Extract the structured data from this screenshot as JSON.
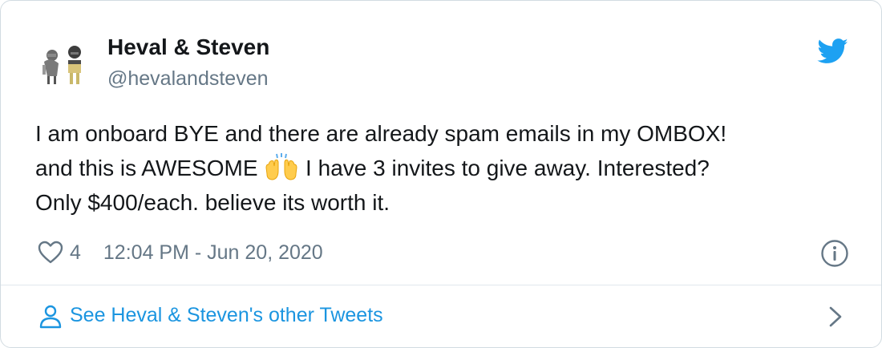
{
  "author": {
    "name": "Heval & Steven",
    "handle": "@hevalandsteven"
  },
  "tweet": {
    "line1": "I am onboard BYE and there are already spam emails in my OMBOX!",
    "line2_before": "and this is AWESOME ",
    "line2_after": " I have 3 invites to give away. Interested?",
    "line3": "Only $400/each. believe its worth it.",
    "emoji": "raising-hands-emoji"
  },
  "meta": {
    "like_count": "4",
    "timestamp": "12:04 PM - Jun 20, 2020"
  },
  "footer": {
    "label": "See Heval & Steven's other Tweets"
  },
  "colors": {
    "text": "#14171a",
    "secondary": "#657786",
    "link": "#1b95e0",
    "twitter_blue": "#1da1f2",
    "border": "#d2dbe1"
  },
  "icons": [
    "avatar",
    "twitter-bird-icon",
    "heart-icon",
    "info-icon",
    "person-icon",
    "chevron-right-icon"
  ]
}
